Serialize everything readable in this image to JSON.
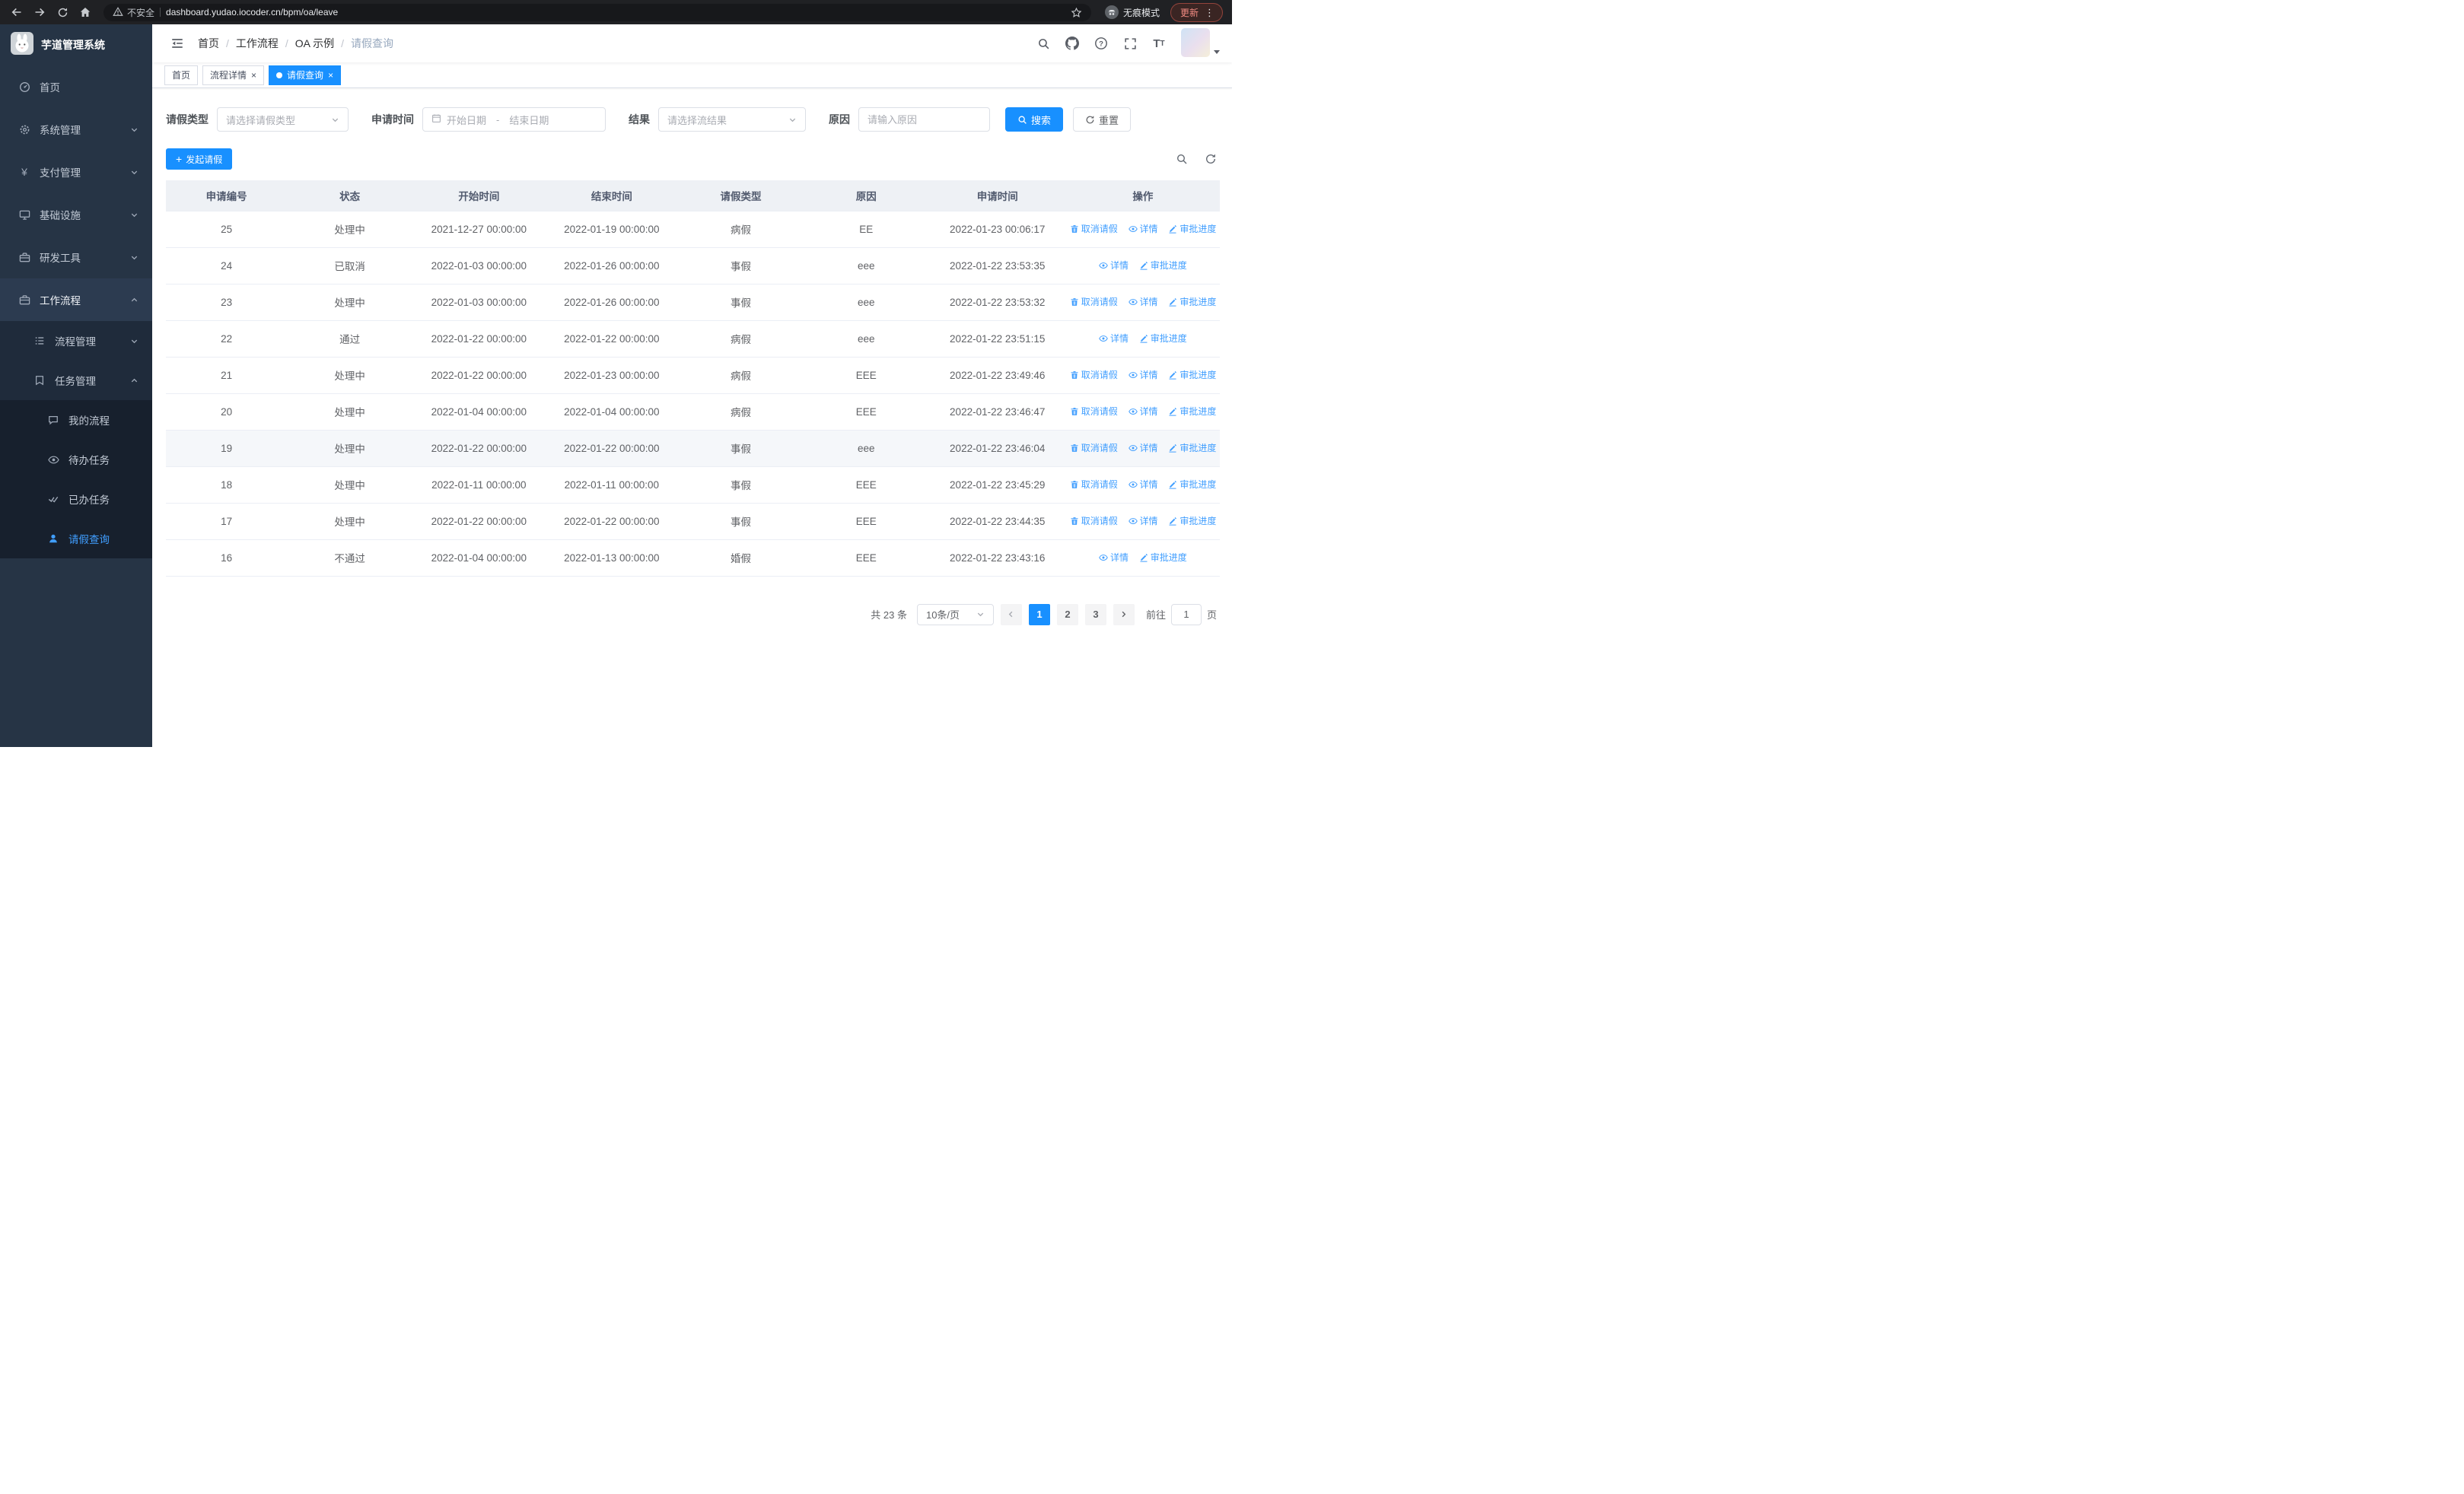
{
  "colors": {
    "primary": "#1890ff",
    "link": "#409eff",
    "sidebar_bg": "#263445",
    "active_menu_text": "#409eff"
  },
  "browser": {
    "security_label": "不安全",
    "url": "dashboard.yudao.iocoder.cn/bpm/oa/leave",
    "incognito_label": "无痕模式",
    "update_label": "更新"
  },
  "sidebar": {
    "title": "芋道管理系统",
    "menu": [
      {
        "label": "首页",
        "icon": "dashboard-icon"
      },
      {
        "label": "系统管理",
        "icon": "gear-icon"
      },
      {
        "label": "支付管理",
        "icon": "yen-icon"
      },
      {
        "label": "基础设施",
        "icon": "monitor-icon"
      },
      {
        "label": "研发工具",
        "icon": "toolbox-icon"
      },
      {
        "label": "工作流程",
        "icon": "briefcase-icon"
      }
    ],
    "submenu": [
      {
        "label": "流程管理",
        "icon": "list-icon"
      },
      {
        "label": "任务管理",
        "icon": "tag-icon"
      }
    ],
    "tasks": [
      {
        "label": "我的流程",
        "icon": "chat-icon"
      },
      {
        "label": "待办任务",
        "icon": "eye-icon"
      },
      {
        "label": "已办任务",
        "icon": "check-icon"
      },
      {
        "label": "请假查询",
        "icon": "user-icon",
        "active": true
      }
    ]
  },
  "header": {
    "breadcrumb": [
      "首页",
      "工作流程",
      "OA 示例",
      "请假查询"
    ]
  },
  "tabs": [
    {
      "label": "首页"
    },
    {
      "label": "流程详情",
      "closable": true
    },
    {
      "label": "请假查询",
      "closable": true,
      "active": true
    }
  ],
  "filters": {
    "leave_type_label": "请假类型",
    "leave_type_placeholder": "请选择请假类型",
    "apply_time_label": "申请时间",
    "start_date_placeholder": "开始日期",
    "range_separator": "-",
    "end_date_placeholder": "结束日期",
    "result_label": "结果",
    "result_placeholder": "请选择流结果",
    "reason_label": "原因",
    "reason_placeholder": "请输入原因",
    "search_button": "搜索",
    "reset_button": "重置"
  },
  "toolbar": {
    "create_button": "发起请假"
  },
  "table": {
    "columns": [
      "申请编号",
      "状态",
      "开始时间",
      "结束时间",
      "请假类型",
      "原因",
      "申请时间",
      "操作"
    ],
    "actions": {
      "cancel": "取消请假",
      "detail": "详情",
      "progress": "审批进度"
    },
    "rows": [
      {
        "id": "25",
        "status": "处理中",
        "start": "2021-12-27 00:00:00",
        "end": "2022-01-19 00:00:00",
        "type": "病假",
        "reason": "EE",
        "applied": "2022-01-23 00:06:17",
        "cancellable": true
      },
      {
        "id": "24",
        "status": "已取消",
        "start": "2022-01-03 00:00:00",
        "end": "2022-01-26 00:00:00",
        "type": "事假",
        "reason": "eee",
        "applied": "2022-01-22 23:53:35",
        "cancellable": false
      },
      {
        "id": "23",
        "status": "处理中",
        "start": "2022-01-03 00:00:00",
        "end": "2022-01-26 00:00:00",
        "type": "事假",
        "reason": "eee",
        "applied": "2022-01-22 23:53:32",
        "cancellable": true
      },
      {
        "id": "22",
        "status": "通过",
        "start": "2022-01-22 00:00:00",
        "end": "2022-01-22 00:00:00",
        "type": "病假",
        "reason": "eee",
        "applied": "2022-01-22 23:51:15",
        "cancellable": false
      },
      {
        "id": "21",
        "status": "处理中",
        "start": "2022-01-22 00:00:00",
        "end": "2022-01-23 00:00:00",
        "type": "病假",
        "reason": "EEE",
        "applied": "2022-01-22 23:49:46",
        "cancellable": true
      },
      {
        "id": "20",
        "status": "处理中",
        "start": "2022-01-04 00:00:00",
        "end": "2022-01-04 00:00:00",
        "type": "病假",
        "reason": "EEE",
        "applied": "2022-01-22 23:46:47",
        "cancellable": true
      },
      {
        "id": "19",
        "status": "处理中",
        "start": "2022-01-22 00:00:00",
        "end": "2022-01-22 00:00:00",
        "type": "事假",
        "reason": "eee",
        "applied": "2022-01-22 23:46:04",
        "cancellable": true,
        "hover": true
      },
      {
        "id": "18",
        "status": "处理中",
        "start": "2022-01-11 00:00:00",
        "end": "2022-01-11 00:00:00",
        "type": "事假",
        "reason": "EEE",
        "applied": "2022-01-22 23:45:29",
        "cancellable": true
      },
      {
        "id": "17",
        "status": "处理中",
        "start": "2022-01-22 00:00:00",
        "end": "2022-01-22 00:00:00",
        "type": "事假",
        "reason": "EEE",
        "applied": "2022-01-22 23:44:35",
        "cancellable": true
      },
      {
        "id": "16",
        "status": "不通过",
        "start": "2022-01-04 00:00:00",
        "end": "2022-01-13 00:00:00",
        "type": "婚假",
        "reason": "EEE",
        "applied": "2022-01-22 23:43:16",
        "cancellable": false
      }
    ]
  },
  "pagination": {
    "total": "共 23 条",
    "page_size": "10条/页",
    "pages": [
      "1",
      "2",
      "3"
    ],
    "active_page": "1",
    "goto_label": "前往",
    "goto_value": "1",
    "goto_suffix": "页"
  }
}
